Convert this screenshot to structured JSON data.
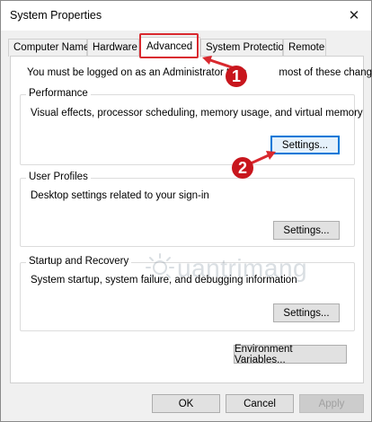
{
  "window": {
    "title": "System Properties",
    "close_glyph": "✕"
  },
  "tabs": [
    {
      "label": "Computer Name",
      "active": false
    },
    {
      "label": "Hardware",
      "active": false
    },
    {
      "label": "Advanced",
      "active": true
    },
    {
      "label": "System Protection",
      "active": false
    },
    {
      "label": "Remote",
      "active": false
    }
  ],
  "admin_note": {
    "before": "You must be logged on as an Administrator to m",
    "after": "most of these changes."
  },
  "groups": {
    "performance": {
      "label": "Performance",
      "description": "Visual effects, processor scheduling, memory usage, and virtual memory",
      "button": "Settings..."
    },
    "user_profiles": {
      "label": "User Profiles",
      "description": "Desktop settings related to your sign-in",
      "button": "Settings..."
    },
    "startup": {
      "label": "Startup and Recovery",
      "description": "System startup, system failure, and debugging information",
      "button": "Settings..."
    }
  },
  "env_button": "Environment Variables...",
  "footer": {
    "ok": "OK",
    "cancel": "Cancel",
    "apply": "Apply"
  },
  "annotations": {
    "badge_1": "1",
    "badge_2": "2",
    "accent_color": "#c8161d"
  },
  "watermark": {
    "text": "uantrimang",
    "icon": "sun-logo"
  },
  "colors": {
    "focus_border": "#0078d7",
    "highlight_box": "#d9292f"
  }
}
